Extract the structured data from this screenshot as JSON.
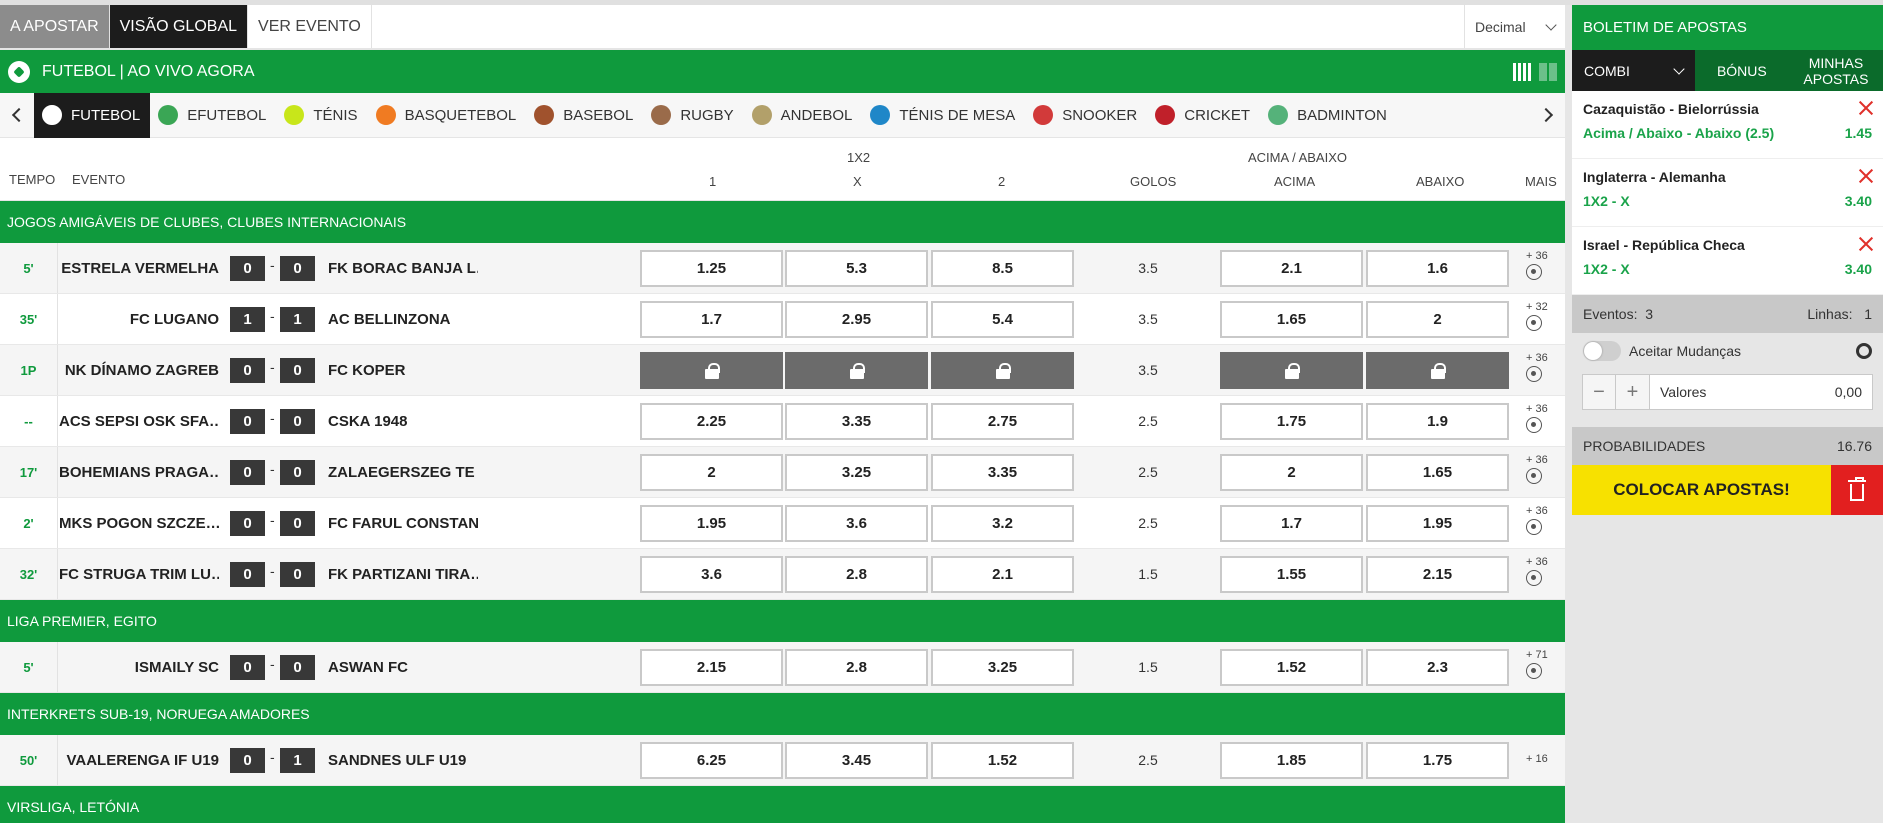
{
  "topnav": {
    "tabs": [
      "A APOSTAR",
      "VISÃO GLOBAL",
      "VER EVENTO"
    ],
    "odds_format": "Decimal"
  },
  "livebar": {
    "title": "FUTEBOL | AO VIVO AGORA"
  },
  "sports": [
    {
      "label": "FUTEBOL",
      "icon": "soccer-icon",
      "color": "#ffffff"
    },
    {
      "label": "EFUTEBOL",
      "icon": "efootball-icon",
      "color": "#3aa655"
    },
    {
      "label": "TÉNIS",
      "icon": "tennis-icon",
      "color": "#c8e61a"
    },
    {
      "label": "BASQUETEBOL",
      "icon": "basketball-icon",
      "color": "#f07b22"
    },
    {
      "label": "BASEBOL",
      "icon": "baseball-icon",
      "color": "#a0522d"
    },
    {
      "label": "RUGBY",
      "icon": "rugby-icon",
      "color": "#9a6b4a"
    },
    {
      "label": "ANDEBOL",
      "icon": "handball-icon",
      "color": "#b2a06a"
    },
    {
      "label": "TÉNIS DE MESA",
      "icon": "table-tennis-icon",
      "color": "#1f87c8"
    },
    {
      "label": "SNOOKER",
      "icon": "snooker-icon",
      "color": "#d23a3a"
    },
    {
      "label": "CRICKET",
      "icon": "cricket-icon",
      "color": "#c0202a"
    },
    {
      "label": "BADMINTON",
      "icon": "badminton-icon",
      "color": "#55b27a"
    }
  ],
  "columns": {
    "tempo": "TEMPO",
    "evento": "EVENTO",
    "group_1x2": "1X2",
    "c1": "1",
    "cx": "X",
    "c2": "2",
    "golos": "GOLOS",
    "group_ou": "ACIMA / ABAIXO",
    "acima": "ACIMA",
    "abaixo": "ABAIXO",
    "mais": "MAIS"
  },
  "leagues": [
    {
      "name": "JOGOS AMIGÁVEIS DE CLUBES, CLUBES INTERNACIONAIS",
      "matches": [
        {
          "time": "5'",
          "home": "ESTRELA VERMELHA",
          "hs": "0",
          "as": "0",
          "away": "FK BORAC BANJA L…",
          "o1": "1.25",
          "ox": "5.3",
          "o2": "8.5",
          "goals": "3.5",
          "over": "2.1",
          "under": "1.6",
          "more": "+ 36",
          "locked": false
        },
        {
          "time": "35'",
          "home": "FC LUGANO",
          "hs": "1",
          "as": "1",
          "away": "AC BELLINZONA",
          "o1": "1.7",
          "ox": "2.95",
          "o2": "5.4",
          "goals": "3.5",
          "over": "1.65",
          "under": "2",
          "more": "+ 32",
          "locked": false
        },
        {
          "time": "1P",
          "home": "NK DÍNAMO ZAGREB",
          "hs": "0",
          "as": "0",
          "away": "FC KOPER",
          "o1": "",
          "ox": "",
          "o2": "",
          "goals": "3.5",
          "over": "",
          "under": "",
          "more": "+ 36",
          "locked": true
        },
        {
          "time": "--",
          "home": "ACS SEPSI OSK SFA…",
          "hs": "0",
          "as": "0",
          "away": "CSKA 1948",
          "o1": "2.25",
          "ox": "3.35",
          "o2": "2.75",
          "goals": "2.5",
          "over": "1.75",
          "under": "1.9",
          "more": "+ 36",
          "locked": false
        },
        {
          "time": "17'",
          "home": "BOHEMIANS PRAGA…",
          "hs": "0",
          "as": "0",
          "away": "ZALAEGERSZEG TE",
          "o1": "2",
          "ox": "3.25",
          "o2": "3.35",
          "goals": "2.5",
          "over": "2",
          "under": "1.65",
          "more": "+ 36",
          "locked": false
        },
        {
          "time": "2'",
          "home": "MKS POGON SZCZE…",
          "hs": "0",
          "as": "0",
          "away": "FC FARUL CONSTAN…",
          "o1": "1.95",
          "ox": "3.6",
          "o2": "3.2",
          "goals": "2.5",
          "over": "1.7",
          "under": "1.95",
          "more": "+ 36",
          "locked": false
        },
        {
          "time": "32'",
          "home": "FC STRUGA TRIM LU…",
          "hs": "0",
          "as": "0",
          "away": "FK PARTIZANI TIRA…",
          "o1": "3.6",
          "ox": "2.8",
          "o2": "2.1",
          "goals": "1.5",
          "over": "1.55",
          "under": "2.15",
          "more": "+ 36",
          "locked": false
        }
      ]
    },
    {
      "name": "LIGA PREMIER, EGITO",
      "matches": [
        {
          "time": "5'",
          "home": "ISMAILY SC",
          "hs": "0",
          "as": "0",
          "away": "ASWAN FC",
          "o1": "2.15",
          "ox": "2.8",
          "o2": "3.25",
          "goals": "1.5",
          "over": "1.52",
          "under": "2.3",
          "more": "+ 71",
          "locked": false
        }
      ]
    },
    {
      "name": "INTERKRETS SUB-19, NORUEGA AMADORES",
      "matches": [
        {
          "time": "50'",
          "home": "VAALERENGA IF U19",
          "hs": "0",
          "as": "1",
          "away": "SANDNES ULF U19",
          "o1": "6.25",
          "ox": "3.45",
          "o2": "1.52",
          "goals": "2.5",
          "over": "1.85",
          "under": "1.75",
          "more": "+ 16",
          "locked": false,
          "no_stats": true
        }
      ]
    },
    {
      "name": "VIRSLIGA, LETÓNIA",
      "matches": []
    }
  ],
  "betslip": {
    "title": "BOLETIM DE APOSTAS",
    "tabs": {
      "combi": "COMBI",
      "bonus": "BÓNUS",
      "my_bets": "MINHAS APOSTAS"
    },
    "bets": [
      {
        "match": "Cazaquistão - Bielorrússia",
        "selection": "Acima / Abaixo - Abaixo (2.5)",
        "price": "1.45"
      },
      {
        "match": "Inglaterra - Alemanha",
        "selection": "1X2 - X",
        "price": "3.40"
      },
      {
        "match": "Israel - República Checa",
        "selection": "1X2 - X",
        "price": "3.40"
      }
    ],
    "events_label": "Eventos:",
    "events_count": "3",
    "lines_label": "Linhas:",
    "lines_count": "1",
    "accept_changes": "Aceitar Mudanças",
    "stake_minus": "−",
    "stake_plus": "+",
    "stake_label": "Valores",
    "stake_value": "0,00",
    "probs_label": "PROBABILIDADES",
    "probs_value": "16.76",
    "place_label": "COLOCAR APOSTAS!"
  },
  "colors": {
    "green": "#0f9a3d",
    "dark_green": "#0b6b2b",
    "yellow": "#f7e100",
    "red": "#e21f1f"
  }
}
